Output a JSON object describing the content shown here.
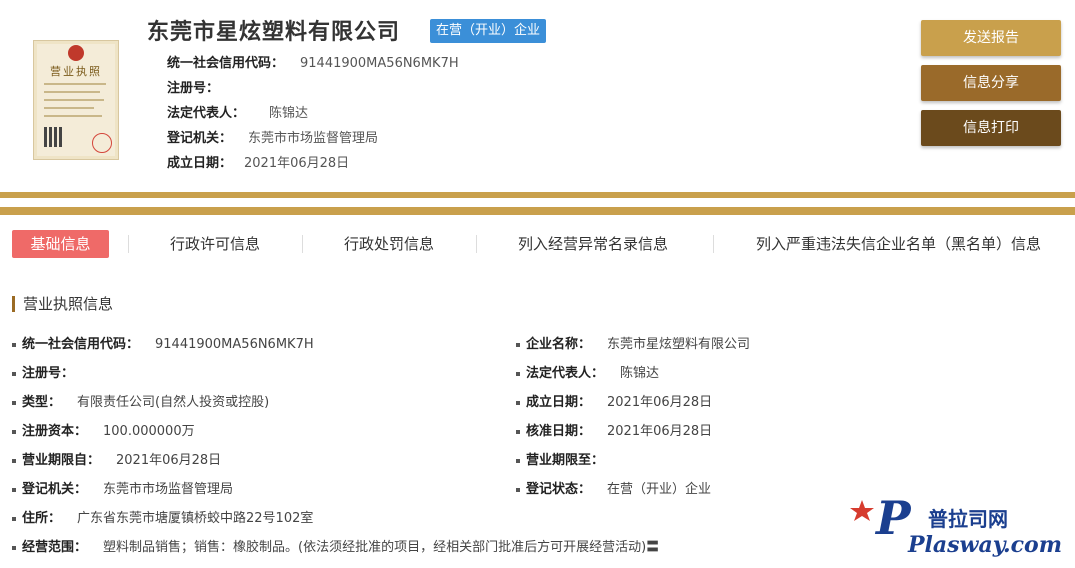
{
  "license": {
    "title": "营业执照"
  },
  "company": {
    "name": "东莞市星炫塑料有限公司",
    "status_badge": "在营（开业）企业"
  },
  "header": {
    "fields": [
      {
        "label": "统一社会信用代码：",
        "value": "91441900MA56N6MK7H"
      },
      {
        "label": "注册号：",
        "value": ""
      },
      {
        "label": "法定代表人：",
        "value": "陈锦达"
      },
      {
        "label": "登记机关：",
        "value": "东莞市市场监督管理局"
      },
      {
        "label": "成立日期：",
        "value": "2021年06月28日"
      }
    ]
  },
  "actions": {
    "send_report": "发送报告",
    "share": "信息分享",
    "print": "信息打印",
    "colors": [
      "#c9a04c",
      "#9a6a2a",
      "#6b4a1c"
    ]
  },
  "tabs": [
    {
      "label": "基础信息",
      "active": true
    },
    {
      "label": "行政许可信息"
    },
    {
      "label": "行政处罚信息"
    },
    {
      "label": "列入经营异常名录信息"
    },
    {
      "label": "列入严重违法失信企业名单（黑名单）信息"
    }
  ],
  "section": {
    "title": "营业执照信息",
    "left": [
      {
        "label": "统一社会信用代码：",
        "value": "91441900MA56N6MK7H"
      },
      {
        "label": "注册号：",
        "value": ""
      },
      {
        "label": "类型：",
        "value": "有限责任公司(自然人投资或控股)"
      },
      {
        "label": "注册资本：",
        "value": "100.000000万"
      },
      {
        "label": "营业期限自：",
        "value": "2021年06月28日"
      },
      {
        "label": "登记机关：",
        "value": "东莞市市场监督管理局"
      },
      {
        "label": "住所：",
        "value": "广东省东莞市塘厦镇桥蛟中路22号102室"
      },
      {
        "label": "经营范围：",
        "value": "塑料制品销售；销售：橡胶制品。(依法须经批准的项目，经相关部门批准后方可开展经营活动)〓"
      }
    ],
    "right": [
      {
        "label": "企业名称：",
        "value": "东莞市星炫塑料有限公司"
      },
      {
        "label": "法定代表人：",
        "value": "陈锦达"
      },
      {
        "label": "成立日期：",
        "value": "2021年06月28日"
      },
      {
        "label": "核准日期：",
        "value": "2021年06月28日"
      },
      {
        "label": "营业期限至：",
        "value": ""
      },
      {
        "label": "登记状态：",
        "value": "在营（开业）企业"
      }
    ]
  },
  "watermark": {
    "cn": "普拉司网",
    "en": "Plasway.com"
  },
  "colors": {
    "gold": "#c9a04c",
    "tab_active": "#ef6a68",
    "badge": "#3b8fd8"
  }
}
